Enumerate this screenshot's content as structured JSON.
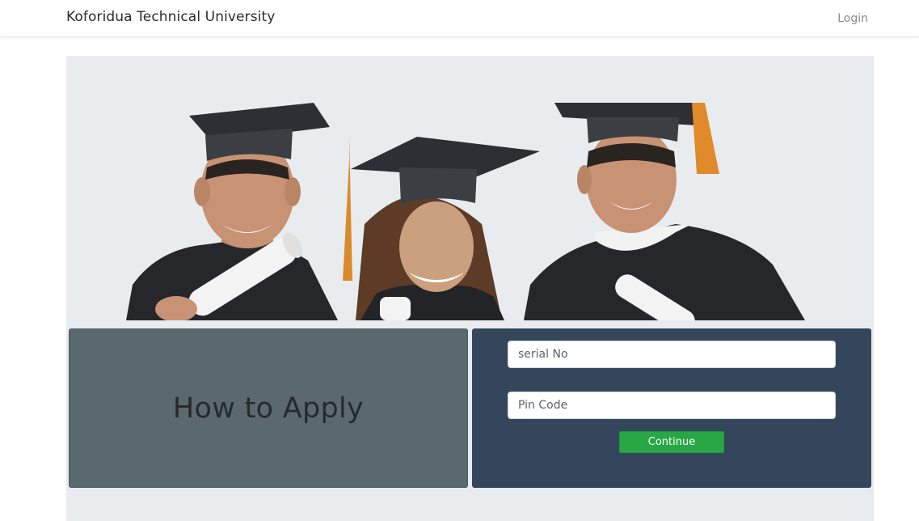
{
  "navbar": {
    "brand": "Koforidua Technical University",
    "login_label": "Login"
  },
  "hero": {
    "image_description_icon": "graduates-photo-icon"
  },
  "info_panel": {
    "heading": "How to Apply"
  },
  "login_form": {
    "serial_placeholder": "serial No",
    "serial_value": "",
    "pin_placeholder": "Pin Code",
    "pin_value": "",
    "continue_label": "Continue"
  },
  "colors": {
    "info_panel_bg": "#5a696e",
    "form_panel_bg": "#34465c",
    "continue_button": "#28a745",
    "jumbotron_bg": "#e9ecef"
  }
}
